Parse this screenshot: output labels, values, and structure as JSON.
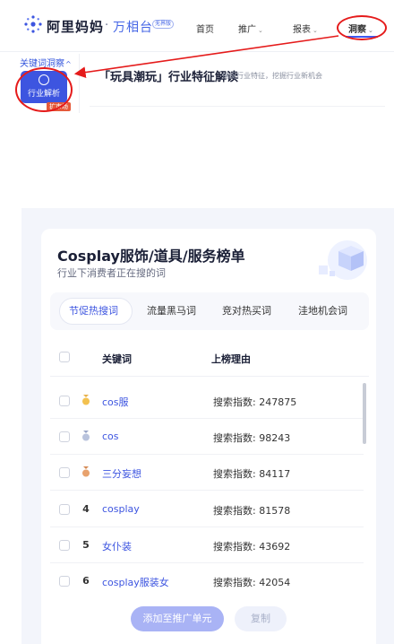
{
  "header": {
    "brand": "阿里妈妈",
    "separator": "·",
    "product": "万相台",
    "badge": "无界版",
    "nav": [
      {
        "label": "首页",
        "has_menu": false
      },
      {
        "label": "推广",
        "has_menu": true
      },
      {
        "label": "报表",
        "has_menu": true
      },
      {
        "label": "洞察",
        "has_menu": true,
        "active": true
      }
    ],
    "chevron": "⌄"
  },
  "sidebar": {
    "group_label": "关键词洞察",
    "group_chevron": "^",
    "active_item": "行业解析",
    "tag": "扩市场"
  },
  "subheader": {
    "title": "「玩具潮玩」行业特征解读",
    "description": "捕捉行业特征，挖掘行业新机会"
  },
  "card": {
    "title": "Cosplay服饰/道具/服务榜单",
    "subtitle": "行业下消费者正在搜的词",
    "tabs": [
      {
        "label": "节促热搜词",
        "active": true
      },
      {
        "label": "流量黑马词",
        "active": false
      },
      {
        "label": "竞对热买词",
        "active": false
      },
      {
        "label": "洼地机会词",
        "active": false
      }
    ],
    "columns": {
      "keyword": "关键词",
      "reason": "上榜理由"
    },
    "rows": [
      {
        "rank": "",
        "medal": "gold",
        "keyword": "cos服",
        "reason": "搜索指数: 247875"
      },
      {
        "rank": "",
        "medal": "silver",
        "keyword": "cos",
        "reason": "搜索指数: 98243"
      },
      {
        "rank": "",
        "medal": "bronze",
        "keyword": "三分妄想",
        "reason": "搜索指数: 84117"
      },
      {
        "rank": "4",
        "medal": "",
        "keyword": "cosplay",
        "reason": "搜索指数: 81578"
      },
      {
        "rank": "5",
        "medal": "",
        "keyword": "女仆装",
        "reason": "搜索指数: 43692"
      },
      {
        "rank": "6",
        "medal": "",
        "keyword": "cosplay服装女",
        "reason": "搜索指数: 42054"
      }
    ],
    "buttons": {
      "primary": "添加至推广单元",
      "secondary": "复制"
    }
  },
  "colors": {
    "accent": "#3d55e0",
    "annotation": "#e51b1b"
  }
}
